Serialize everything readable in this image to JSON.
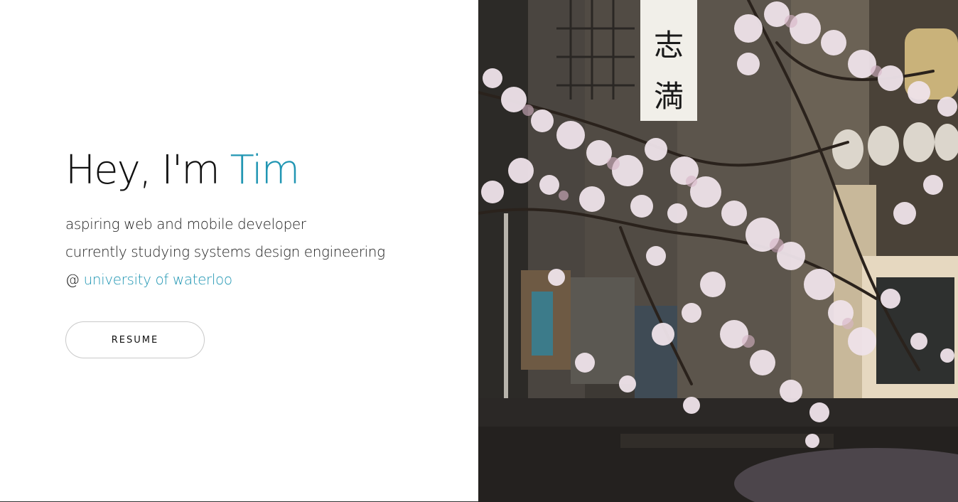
{
  "hero": {
    "greeting": "Hey, I'm",
    "name": "Tim",
    "lines": [
      "aspiring web and mobile developer",
      "currently studying systems design engineering"
    ],
    "at_symbol": "@",
    "school_link": "university of waterloo",
    "resume_button": "RESUME"
  },
  "photo": {
    "description_icon": "cherry-blossom-street-photo",
    "sign_text": "志満"
  },
  "colors": {
    "accent": "#2196b3",
    "text": "#111111",
    "background": "#ffffff"
  }
}
